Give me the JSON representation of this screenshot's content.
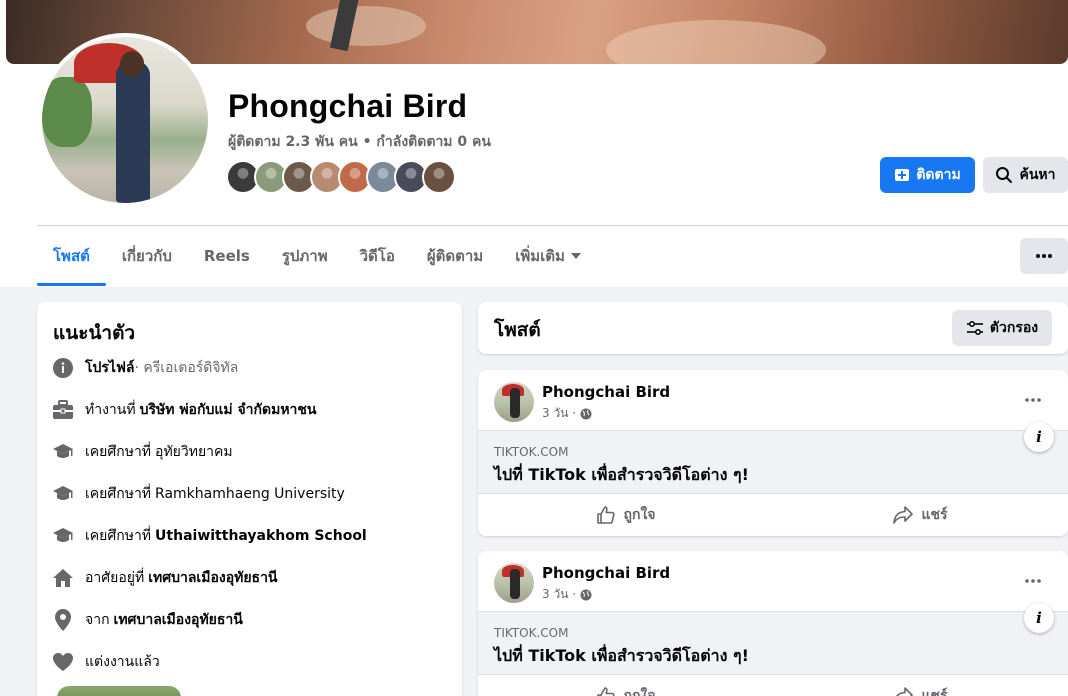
{
  "profile": {
    "name": "Phongchai Bird",
    "stats": "ผู้ติดตาม 2.3 พัน คน • กำลังติดตาม 0 คน",
    "follow_label": "ติดตาม",
    "search_label": "ค้นหา",
    "friend_colors": [
      "#3b3b3b",
      "#8a9a7a",
      "#6b5a4a",
      "#b88a72",
      "#c06a4a",
      "#7a8a9a",
      "#4a4a5a",
      "#6a5040"
    ]
  },
  "tabs": [
    {
      "label": "โพสต์",
      "active": true
    },
    {
      "label": "เกี่ยวกับ"
    },
    {
      "label": "Reels"
    },
    {
      "label": "รูปภาพ"
    },
    {
      "label": "วิดีโอ"
    },
    {
      "label": "ผู้ติดตาม"
    },
    {
      "label": "เพิ่มเติม"
    }
  ],
  "intro": {
    "title": "แนะนำตัว",
    "rows": [
      {
        "icon": "info-icon",
        "pre": "โปรไฟล์",
        "muted": " · ครีเอเตอร์ดิจิทัล"
      },
      {
        "icon": "briefcase-icon",
        "pre": "ทำงานที่",
        "strong": "บริษัท พ่อกับแม่ จำกัดมหาชน"
      },
      {
        "icon": "graduation-cap-icon",
        "pre": "เคยศึกษาที่",
        "muted_inline": "อุทัยวิทยาคม"
      },
      {
        "icon": "graduation-cap-icon",
        "pre": "เคยศึกษาที่",
        "muted_inline": "Ramkhamhaeng University"
      },
      {
        "icon": "graduation-cap-icon",
        "pre": "เคยศึกษาที่",
        "strong": "Uthaiwitthayakhom School"
      },
      {
        "icon": "home-icon",
        "pre": "อาศัยอยู่ที่",
        "strong": "เทศบาลเมืองอุทัยธานี"
      },
      {
        "icon": "location-pin-icon",
        "pre": "จาก",
        "strong": "เทศบาลเมืองอุทัยธานี"
      },
      {
        "icon": "heart-icon",
        "pre": "แต่งงานแล้ว"
      }
    ]
  },
  "posts_header": {
    "title": "โพสต์",
    "filter_label": "ตัวกรอง"
  },
  "posts": [
    {
      "author": "Phongchai Bird",
      "time": "3 วัน ·",
      "domain": "TIKTOK.COM",
      "link_title": "ไปที่ TikTok เพื่อสำรวจวิดีโอต่าง ๆ!",
      "like_label": "ถูกใจ",
      "share_label": "แชร์"
    },
    {
      "author": "Phongchai Bird",
      "time": "3 วัน ·",
      "domain": "TIKTOK.COM",
      "link_title": "ไปที่ TikTok เพื่อสำรวจวิดีโอต่าง ๆ!",
      "like_label": "ถูกใจ",
      "share_label": "แชร์"
    }
  ]
}
